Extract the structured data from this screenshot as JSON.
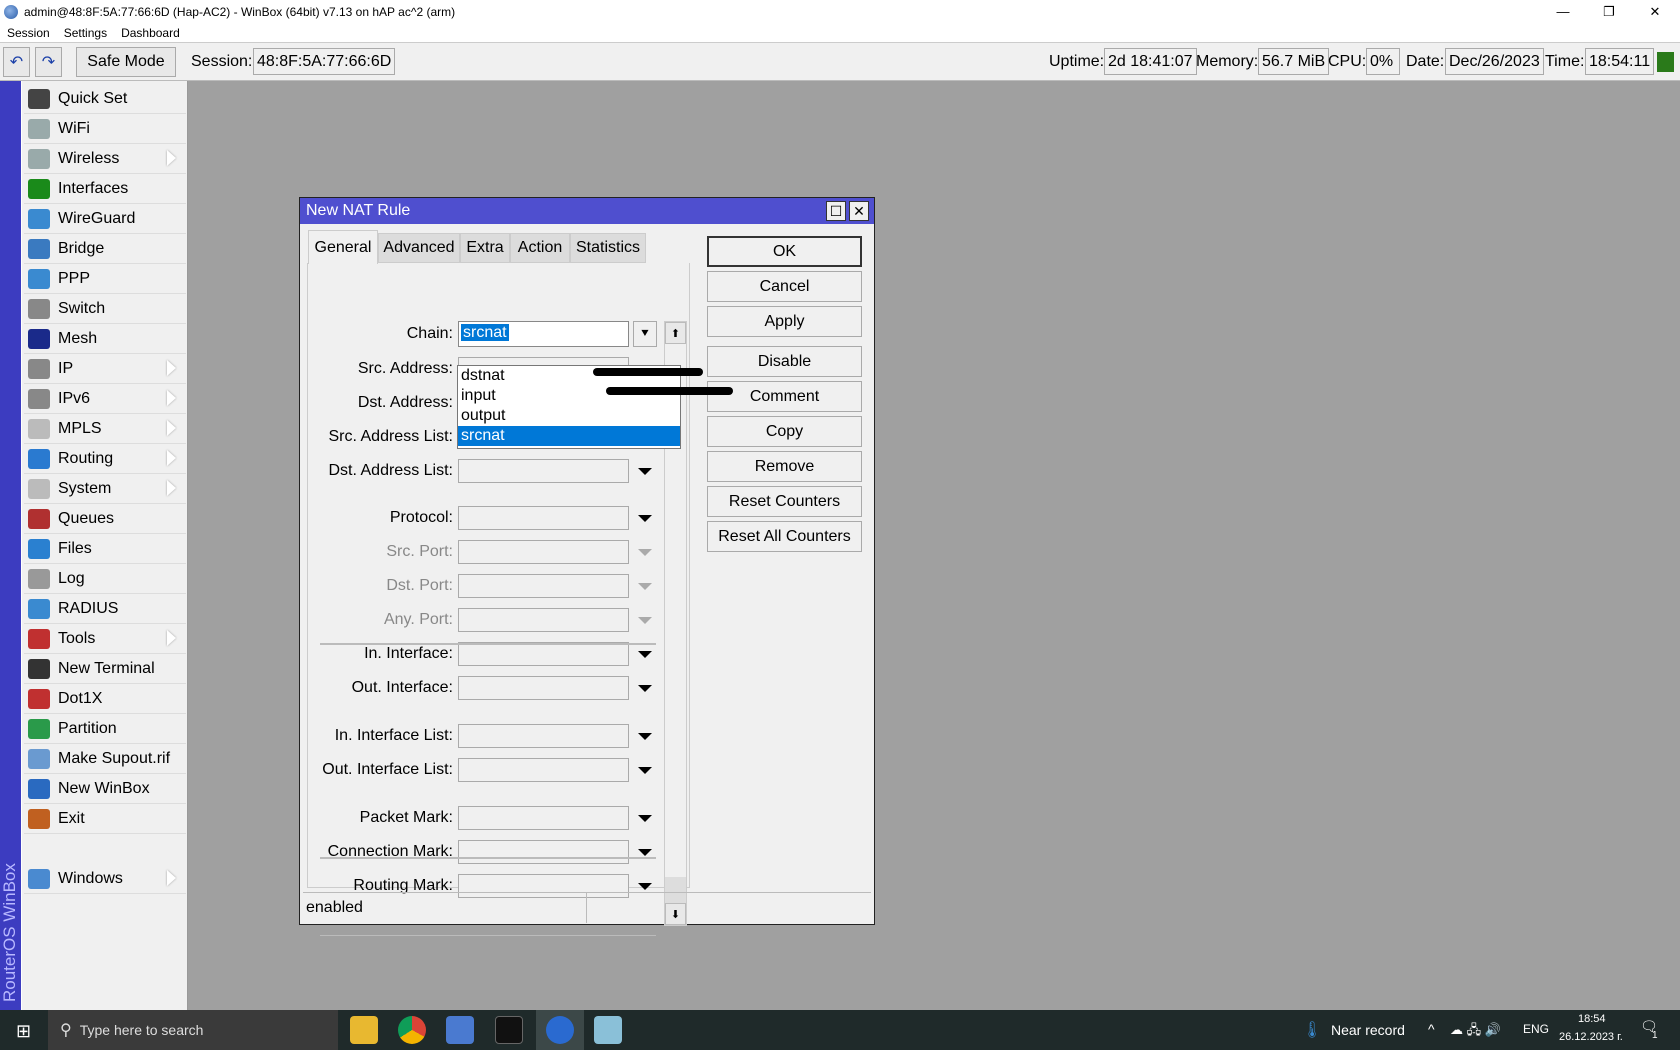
{
  "window": {
    "title": "admin@48:8F:5A:77:66:6D (Hap-AC2) - WinBox (64bit) v7.13 on hAP ac^2 (arm)",
    "minimize": "—",
    "restore": "❐",
    "close": "✕"
  },
  "menubar": [
    "Session",
    "Settings",
    "Dashboard"
  ],
  "toolbar": {
    "undo": "↶",
    "redo": "↷",
    "safe_mode": "Safe Mode",
    "session_label": "Session:",
    "session_value": "48:8F:5A:77:66:6D",
    "uptime_label": "Uptime:",
    "uptime": "2d 18:41:07",
    "memory_label": "Memory:",
    "memory": "56.7 MiB",
    "cpu_label": "CPU:",
    "cpu": "0%",
    "date_label": "Date:",
    "date": "Dec/26/2023",
    "time_label": "Time:",
    "time": "18:54:11"
  },
  "sidebar": {
    "brand": "RouterOS WinBox",
    "items": [
      {
        "label": "Quick Set",
        "icon": "wand-icon",
        "color": "#444",
        "sub": false
      },
      {
        "label": "WiFi",
        "icon": "wifi-icon",
        "color": "#9aa",
        "sub": false
      },
      {
        "label": "Wireless",
        "icon": "wireless-icon",
        "color": "#9aa",
        "sub": true
      },
      {
        "label": "Interfaces",
        "icon": "nic-icon",
        "color": "#1a8a1a",
        "sub": false
      },
      {
        "label": "WireGuard",
        "icon": "wireguard-icon",
        "color": "#3a8ad0",
        "sub": false
      },
      {
        "label": "Bridge",
        "icon": "bridge-icon",
        "color": "#3a7ac0",
        "sub": false
      },
      {
        "label": "PPP",
        "icon": "ppp-icon",
        "color": "#3a8ad0",
        "sub": false
      },
      {
        "label": "Switch",
        "icon": "switch-icon",
        "color": "#888",
        "sub": false
      },
      {
        "label": "Mesh",
        "icon": "mesh-icon",
        "color": "#1a2a8a",
        "sub": false
      },
      {
        "label": "IP",
        "icon": "ip-icon",
        "color": "#888",
        "sub": true
      },
      {
        "label": "IPv6",
        "icon": "ipv6-icon",
        "color": "#888",
        "sub": true
      },
      {
        "label": "MPLS",
        "icon": "mpls-icon",
        "color": "#bbb",
        "sub": true
      },
      {
        "label": "Routing",
        "icon": "routing-icon",
        "color": "#2a7ad0",
        "sub": true
      },
      {
        "label": "System",
        "icon": "gear-icon",
        "color": "#bbb",
        "sub": true
      },
      {
        "label": "Queues",
        "icon": "queues-icon",
        "color": "#b03030",
        "sub": false
      },
      {
        "label": "Files",
        "icon": "folder-icon",
        "color": "#2a80d0",
        "sub": false
      },
      {
        "label": "Log",
        "icon": "log-icon",
        "color": "#999",
        "sub": false
      },
      {
        "label": "RADIUS",
        "icon": "radius-icon",
        "color": "#3a8ad0",
        "sub": false
      },
      {
        "label": "Tools",
        "icon": "tools-icon",
        "color": "#c03030",
        "sub": true
      },
      {
        "label": "New Terminal",
        "icon": "terminal-icon",
        "color": "#333",
        "sub": false
      },
      {
        "label": "Dot1X",
        "icon": "dot1x-icon",
        "color": "#c03030",
        "sub": false
      },
      {
        "label": "Partition",
        "icon": "partition-icon",
        "color": "#2a9a4a",
        "sub": false
      },
      {
        "label": "Make Supout.rif",
        "icon": "supout-icon",
        "color": "#6a9ad0",
        "sub": false
      },
      {
        "label": "New WinBox",
        "icon": "winbox-icon",
        "color": "#2a6ac0",
        "sub": false
      },
      {
        "label": "Exit",
        "icon": "exit-icon",
        "color": "#c06020",
        "sub": false
      }
    ],
    "windows": {
      "label": "Windows",
      "icon": "windows-icon",
      "color": "#4a8ad0",
      "sub": true
    }
  },
  "dialog": {
    "title": "New NAT Rule",
    "maximize": "☐",
    "close": "✕",
    "tabs": [
      "General",
      "Advanced",
      "Extra",
      "Action",
      "Statistics"
    ],
    "chain_label": "Chain:",
    "chain_value": "srcnat",
    "chain_options": [
      "dstnat",
      "input",
      "output",
      "srcnat"
    ],
    "rows": [
      {
        "label": "Src. Address:",
        "disabled": false
      },
      {
        "label": "Dst. Address:",
        "disabled": false
      },
      {
        "label": "Src. Address List:",
        "disabled": false
      },
      {
        "label": "Dst. Address List:",
        "disabled": false
      },
      {
        "label": "Protocol:",
        "disabled": false
      },
      {
        "label": "Src. Port:",
        "disabled": true
      },
      {
        "label": "Dst. Port:",
        "disabled": true
      },
      {
        "label": "Any. Port:",
        "disabled": true
      },
      {
        "label": "In. Interface:",
        "disabled": false
      },
      {
        "label": "Out. Interface:",
        "disabled": false
      },
      {
        "label": "In. Interface List:",
        "disabled": false
      },
      {
        "label": "Out. Interface List:",
        "disabled": false
      },
      {
        "label": "Packet Mark:",
        "disabled": false
      },
      {
        "label": "Connection Mark:",
        "disabled": false
      },
      {
        "label": "Routing Mark:",
        "disabled": false
      }
    ],
    "buttons": [
      "OK",
      "Cancel",
      "Apply",
      "Disable",
      "Comment",
      "Copy",
      "Remove",
      "Reset Counters",
      "Reset All Counters"
    ],
    "status": "enabled"
  },
  "taskbar": {
    "search_placeholder": "Type here to search",
    "weather": "Near record",
    "lang": "ENG",
    "time": "18:54",
    "date": "26.12.2023 г.",
    "notif_count": "1"
  }
}
